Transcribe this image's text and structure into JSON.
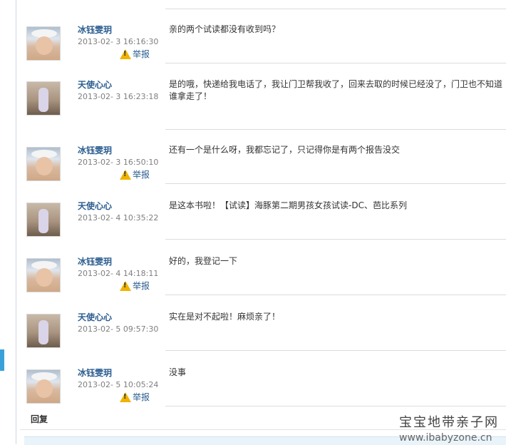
{
  "messages": [
    {
      "name": "冰钰雯玥",
      "time": "2013-02- 3 16:16:30",
      "report": "举报",
      "content": "亲的两个试读都没有收到吗？",
      "avatar": "child-with-bow"
    },
    {
      "name": "天使心心",
      "time": "2013-02- 3 16:23:18",
      "report": "",
      "content": "是的哦，快递给我电话了，我让门卫帮我收了，回来去取的时候已经没了，门卫也不知道谁拿走了！",
      "avatar": "child-standing"
    },
    {
      "name": "冰钰雯玥",
      "time": "2013-02- 3 16:50:10",
      "report": "举报",
      "content": "还有一个是什么呀，我都忘记了，只记得你是有两个报告没交",
      "avatar": "child-with-bow"
    },
    {
      "name": "天使心心",
      "time": "2013-02- 4 10:35:22",
      "report": "",
      "content": "是这本书啦！【试读】海豚第二期男孩女孩试读-DC、芭比系列",
      "avatar": "child-standing"
    },
    {
      "name": "冰钰雯玥",
      "time": "2013-02- 4 14:18:11",
      "report": "举报",
      "content": "好的，我登记一下",
      "avatar": "child-with-bow"
    },
    {
      "name": "天使心心",
      "time": "2013-02- 5 09:57:30",
      "report": "",
      "content": "实在是对不起啦！麻烦亲了！",
      "avatar": "child-standing"
    },
    {
      "name": "冰钰雯玥",
      "time": "2013-02- 5 10:05:24",
      "report": "举报",
      "content": "没事",
      "avatar": "child-with-bow"
    }
  ],
  "reply": {
    "label": "回复"
  },
  "watermark": {
    "title": "宝宝地带亲子网",
    "url": "www.ibabyzone.cn"
  },
  "colors": {
    "name": "#2a5c8f",
    "time": "#7f7f7f",
    "warning": "#f0b400",
    "accent": "#3aa1d8"
  },
  "icons": {
    "report": "warning-triangle-icon"
  }
}
